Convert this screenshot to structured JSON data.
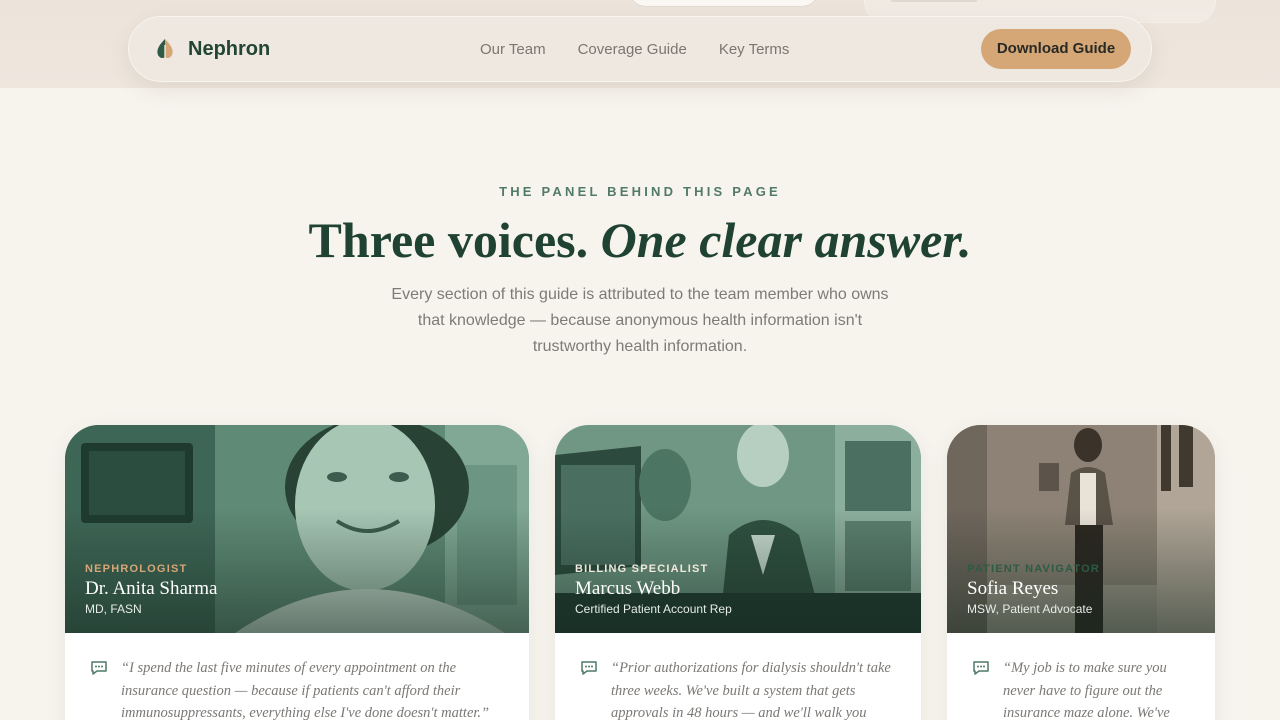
{
  "brand": {
    "name": "Nephron"
  },
  "nav": {
    "links": [
      "Our Team",
      "Coverage Guide",
      "Key Terms"
    ],
    "cta": "Download Guide"
  },
  "hero": {
    "eyebrow": "THE PANEL BEHIND THIS PAGE",
    "headline_plain": "Three voices.",
    "headline_italic": "One clear answer.",
    "subcopy": "Every section of this guide is attributed to the team member who owns that knowledge — because anonymous health information isn't trustworthy health information."
  },
  "team": [
    {
      "role": "NEPHROLOGIST",
      "name": "Dr. Anita Sharma",
      "credentials": "MD, FASN",
      "quote": "“I spend the last five minutes of every appointment on the insurance question — because if patients can't afford their immunosuppressants, everything else I've done doesn't matter.”"
    },
    {
      "role": "BILLING SPECIALIST",
      "name": "Marcus Webb",
      "credentials": "Certified Patient Account Rep",
      "quote": "“Prior authorizations for dialysis shouldn't take three weeks. We've built a system that gets approvals in 48 hours — and we'll walk you through it.”"
    },
    {
      "role": "PATIENT NAVIGATOR",
      "name": "Sofia Reyes",
      "credentials": "MSW, Patient Advocate",
      "quote": "“My job is to make sure you never have to figure out the insurance maze alone. We've mapped every step.”"
    }
  ],
  "colors": {
    "brand_green": "#1f4232",
    "accent_tan": "#d5a676",
    "background": "#f7f4ee"
  }
}
